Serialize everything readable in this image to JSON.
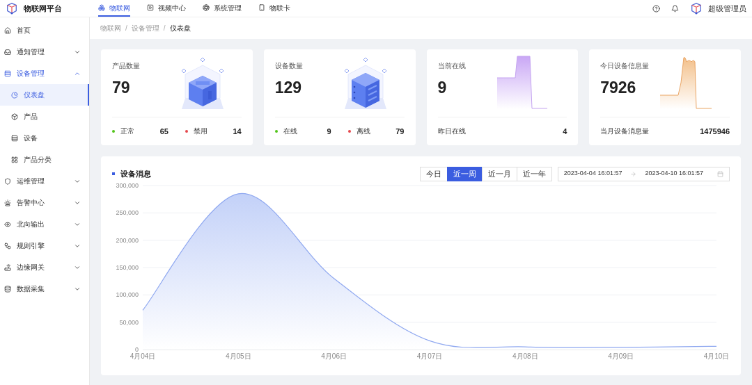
{
  "header": {
    "logo_text": "物联网平台",
    "nav": [
      {
        "label": "物联网",
        "selected": true
      },
      {
        "label": "视频中心",
        "selected": false
      },
      {
        "label": "系统管理",
        "selected": false
      },
      {
        "label": "物联卡",
        "selected": false
      }
    ],
    "user": "超级管理员"
  },
  "sidebar": {
    "items": [
      {
        "kind": "link",
        "label": "首页"
      },
      {
        "kind": "group",
        "label": "通知管理",
        "expanded": false
      },
      {
        "kind": "group",
        "label": "设备管理",
        "expanded": true,
        "children": [
          {
            "label": "仪表盘",
            "selected": true
          },
          {
            "label": "产品",
            "selected": false
          },
          {
            "label": "设备",
            "selected": false
          },
          {
            "label": "产品分类",
            "selected": false
          }
        ]
      },
      {
        "kind": "group",
        "label": "运维管理",
        "expanded": false
      },
      {
        "kind": "group",
        "label": "告警中心",
        "expanded": false
      },
      {
        "kind": "group",
        "label": "北向输出",
        "expanded": false
      },
      {
        "kind": "group",
        "label": "规则引擎",
        "expanded": false
      },
      {
        "kind": "group",
        "label": "边缘网关",
        "expanded": false
      },
      {
        "kind": "group",
        "label": "数据采集",
        "expanded": false
      }
    ]
  },
  "breadcrumb": {
    "separator": "/",
    "items": [
      "物联网",
      "设备管理",
      "仪表盘"
    ]
  },
  "stat_cards": [
    {
      "kind": "product",
      "title": "产品数量",
      "value": "79",
      "footer": [
        {
          "label": "正常",
          "value": "65",
          "color": "#52c41a"
        },
        {
          "label": "禁用",
          "value": "14",
          "color": "#e5484d"
        }
      ]
    },
    {
      "kind": "device",
      "title": "设备数量",
      "value": "129",
      "footer": [
        {
          "label": "在线",
          "value": "9",
          "color": "#52c41a"
        },
        {
          "label": "离线",
          "value": "79",
          "color": "#e5484d"
        }
      ]
    },
    {
      "kind": "online",
      "title": "当前在线",
      "value": "9",
      "footer": [
        {
          "label": "昨日在线",
          "value": "4"
        }
      ]
    },
    {
      "kind": "messages",
      "title": "今日设备信息量",
      "value": "7926",
      "footer": [
        {
          "label": "当月设备消息量",
          "value": "1475946"
        }
      ]
    }
  ],
  "messages_panel": {
    "title": "设备消息",
    "ranges": [
      {
        "label": "今日",
        "selected": false
      },
      {
        "label": "近一周",
        "selected": true
      },
      {
        "label": "近一月",
        "selected": false
      },
      {
        "label": "近一年",
        "selected": false
      }
    ],
    "date_range": {
      "start": "2023-04-04 16:01:57",
      "end": "2023-04-10 16:01:57"
    },
    "chart_data": {
      "type": "area",
      "categories": [
        "4月04日",
        "4月05日",
        "4月06日",
        "4月07日",
        "4月08日",
        "4月09日",
        "4月10日"
      ],
      "grid": true,
      "series": [
        {
          "color": "#8fa8f0",
          "values": [
            72000,
            285000,
            130000,
            16000,
            5000,
            4000,
            6000
          ]
        }
      ],
      "ylim": [
        0,
        300000
      ],
      "yticks": [
        {
          "value": 0,
          "label": "0"
        },
        {
          "value": 50000,
          "label": "50,000"
        },
        {
          "value": 100000,
          "label": "100,000"
        },
        {
          "value": 150000,
          "label": "150,000"
        },
        {
          "value": 200000,
          "label": "200,000"
        },
        {
          "value": 250000,
          "label": "250,000"
        },
        {
          "value": 300000,
          "label": "300,000"
        }
      ]
    }
  }
}
